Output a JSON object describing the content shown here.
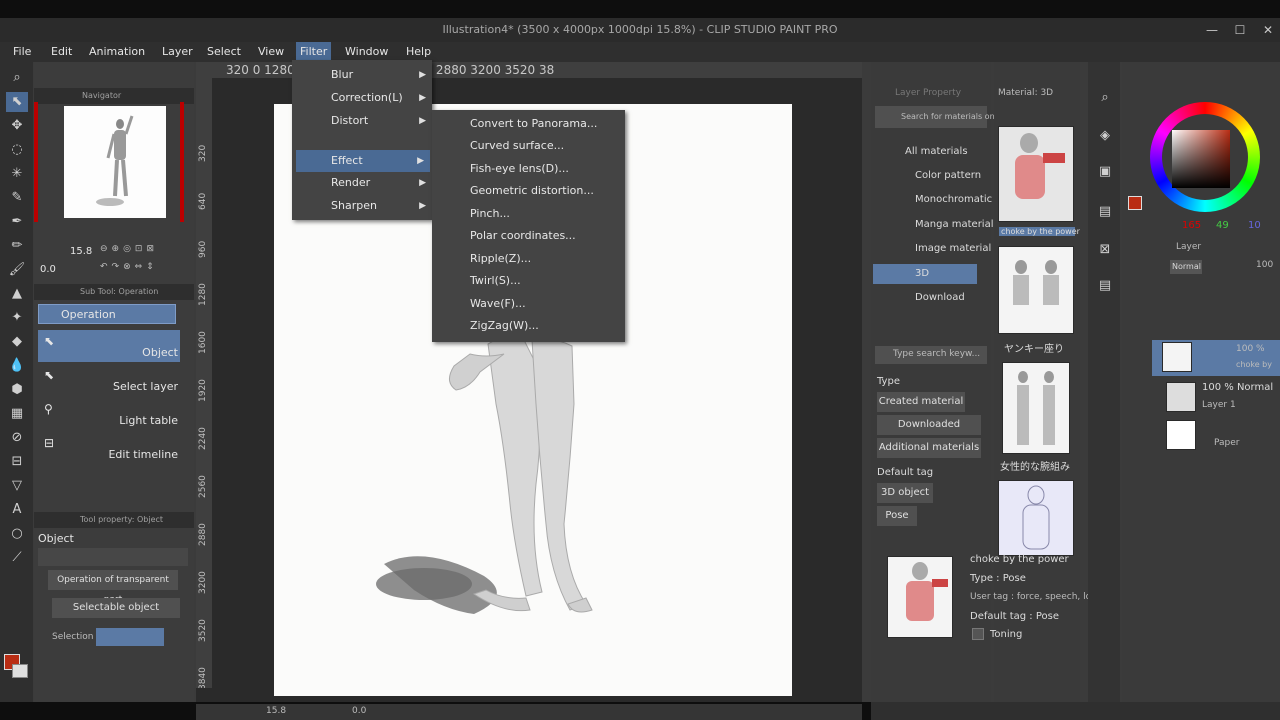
{
  "window": {
    "title": "Illustration4* (3500 x 4000px 1000dpi 15.8%) - CLIP STUDIO PAINT PRO",
    "min": "—",
    "max": "☐",
    "close": "✕"
  },
  "menubar": [
    "File",
    "Edit",
    "Animation",
    "Layer",
    "Select",
    "View",
    "Filter",
    "Window",
    "Help"
  ],
  "filter_menu": [
    {
      "label": "Blur",
      "arrow": "▶"
    },
    {
      "label": "Correction(L)",
      "arrow": "▶"
    },
    {
      "label": "Distort",
      "arrow": "▶"
    },
    {
      "label": "Effect",
      "arrow": "▶"
    },
    {
      "label": "Render",
      "arrow": "▶"
    },
    {
      "label": "Sharpen",
      "arrow": "▶"
    }
  ],
  "effect_menu": [
    "Convert to Panorama...",
    "Curved surface...",
    "Fish-eye lens(D)...",
    "Geometric distortion...",
    "Pinch...",
    "Polar coordinates...",
    "Ripple(Z)...",
    "Twirl(S)...",
    "Wave(F)...",
    "ZigZag(W)..."
  ],
  "ruler_h": "320  0  1280 1600 1920 2240 2560 2880 3200 3520 38",
  "ruler_v": [
    "320",
    "640",
    "960",
    "1280",
    "1600",
    "1920",
    "2240",
    "2560",
    "2880",
    "3200",
    "3520",
    "3840"
  ],
  "navigator": {
    "title": "Navigator",
    "zoom": "15.8",
    "angle": "0.0"
  },
  "subtool": {
    "title": "Sub Tool: Operation",
    "group": "Operation",
    "items": [
      "Object",
      "Select layer",
      "Light table",
      "Edit timeline"
    ]
  },
  "tool_property": {
    "title": "Tool property: Object",
    "section": "Object",
    "dropdown1": "Operation of transparent part",
    "dropdown2": "Selectable object",
    "selection_label": "Selection"
  },
  "material": {
    "tabs": [
      "Layer Property",
      "Material: 3D"
    ],
    "search_placeholder": "Search for materials on A",
    "tree": [
      "All materials",
      "Color pattern",
      "Monochromatic",
      "Manga material",
      "Image material",
      "3D",
      "Download"
    ],
    "thumbs": [
      "choke by the power",
      "ヤンキー座り",
      "女性的な腕組み"
    ],
    "keyword_placeholder": "Type search keyw...",
    "type_label": "Type",
    "type_buttons": [
      "Created material",
      "Downloaded material",
      "Additional materials"
    ],
    "default_tag_label": "Default tag",
    "tag_buttons": [
      "3D object",
      "Pose"
    ],
    "detail": {
      "name": "choke by the power",
      "type": "Type : Pose",
      "user_tag": "User tag : force, speech, lord",
      "default_tag": "Default tag : Pose",
      "toning": "Toning"
    }
  },
  "color": {
    "r": "165",
    "g": "49",
    "b": "10",
    "accent": "#b92d14"
  },
  "layers": {
    "title": "Layer",
    "blend": "Normal",
    "opacity": "100",
    "items": [
      {
        "opacity": "100 %",
        "name": "choke by"
      },
      {
        "opacity": "100 % Normal",
        "name": "Layer 1"
      },
      {
        "opacity": "",
        "name": "Paper"
      }
    ]
  },
  "status": {
    "zoom": "15.8",
    "angle": "0.0"
  }
}
